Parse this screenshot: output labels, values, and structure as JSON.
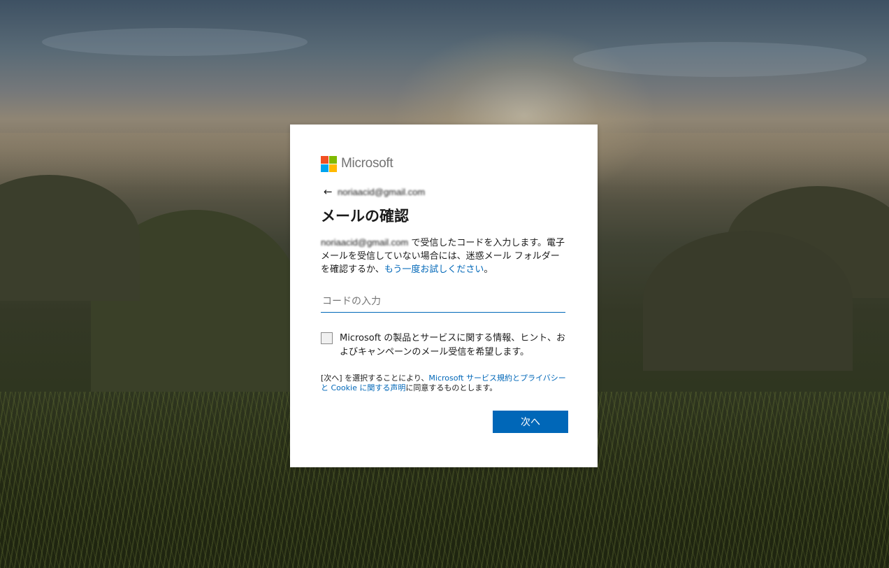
{
  "brand": {
    "name": "Microsoft",
    "logo_colors": [
      "#f25022",
      "#7fba00",
      "#00a4ef",
      "#ffb900"
    ],
    "accent_color": "#0067b8"
  },
  "identity": {
    "back_icon": "arrow-left-icon",
    "email": "noriaacid@gmail.com"
  },
  "title": "メールの確認",
  "description": {
    "email": "noriaacid@gmail.com",
    "part1": " で受信したコードを入力します。電子メールを受信していない場合には、迷惑メール フォルダーを確認するか、",
    "retry_link": "もう一度お試しください",
    "end": "。"
  },
  "code_input": {
    "placeholder": "コードの入力",
    "value": ""
  },
  "marketing_checkbox": {
    "checked": false,
    "label": "Microsoft の製品とサービスに関する情報、ヒント、およびキャンペーンのメール受信を希望します。"
  },
  "terms": {
    "part1": "[次へ] を選択することにより、",
    "services_link": "Microsoft サービス規約",
    "and": "と",
    "privacy_link": "プライバシーと Cookie に関する声明",
    "end": "に同意するものとします。"
  },
  "next_button": {
    "label": "次へ"
  }
}
